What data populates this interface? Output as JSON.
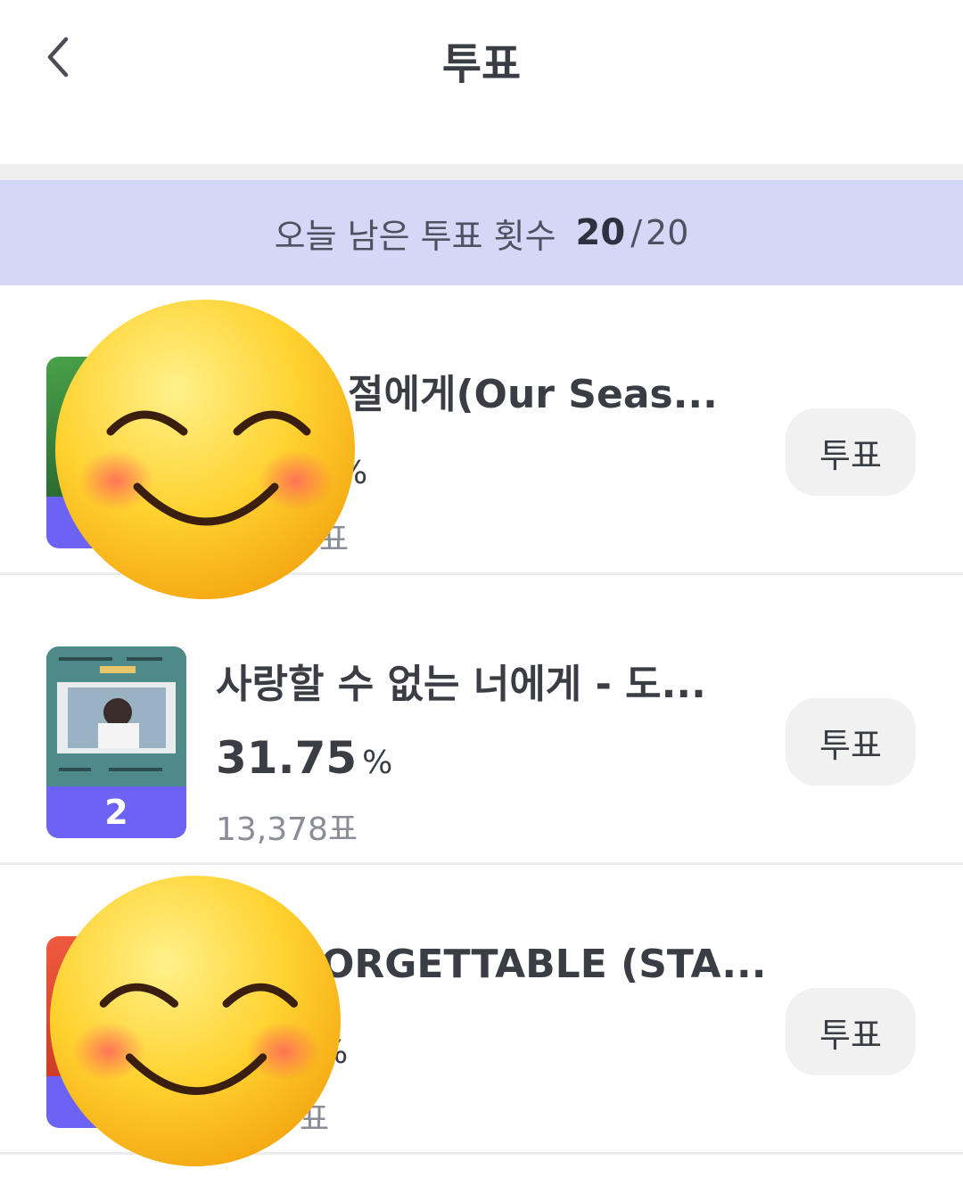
{
  "header": {
    "title": "투표",
    "back_icon": "chevron-left-icon"
  },
  "remaining": {
    "label": "오늘 남은 투표 횟수",
    "count": "20",
    "separator": "/",
    "total": "20"
  },
  "vote_button_label": "투표",
  "pct_unit": "%",
  "items": [
    {
      "title_visible": "절에게(Our Seas...",
      "rank": "",
      "percent_visible": "%",
      "votes_visible": "표",
      "thumb_colors": [
        "#3c8a3b",
        "#1f5a2a"
      ]
    },
    {
      "title": "사랑할 수 없는 너에게 - 도...",
      "rank": "2",
      "percent": "31.75",
      "votes": "13,378표",
      "thumb_colors": [
        "#4f8a8a",
        "#dfe3e6"
      ]
    },
    {
      "title_visible": "ORGETTABLE (STA...",
      "rank": "",
      "percent_visible": "%",
      "votes_visible": "표",
      "thumb_colors": [
        "#e2442f",
        "#c23220"
      ]
    }
  ],
  "overlay_icons": [
    "smiling-face-emoji-icon",
    "smiling-face-emoji-icon"
  ],
  "colors": {
    "accent": "#6c63f5",
    "remain_bg": "#d5d7f6",
    "button_bg": "#f1f1f2"
  }
}
